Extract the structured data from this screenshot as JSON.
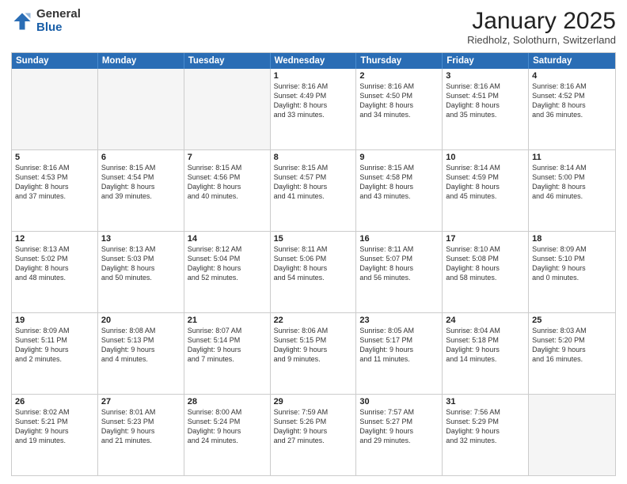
{
  "header": {
    "logo_general": "General",
    "logo_blue": "Blue",
    "title": "January 2025",
    "subtitle": "Riedholz, Solothurn, Switzerland"
  },
  "days_of_week": [
    "Sunday",
    "Monday",
    "Tuesday",
    "Wednesday",
    "Thursday",
    "Friday",
    "Saturday"
  ],
  "weeks": [
    [
      {
        "day": "",
        "info": "",
        "empty": true
      },
      {
        "day": "",
        "info": "",
        "empty": true
      },
      {
        "day": "",
        "info": "",
        "empty": true
      },
      {
        "day": "1",
        "info": "Sunrise: 8:16 AM\nSunset: 4:49 PM\nDaylight: 8 hours\nand 33 minutes."
      },
      {
        "day": "2",
        "info": "Sunrise: 8:16 AM\nSunset: 4:50 PM\nDaylight: 8 hours\nand 34 minutes."
      },
      {
        "day": "3",
        "info": "Sunrise: 8:16 AM\nSunset: 4:51 PM\nDaylight: 8 hours\nand 35 minutes."
      },
      {
        "day": "4",
        "info": "Sunrise: 8:16 AM\nSunset: 4:52 PM\nDaylight: 8 hours\nand 36 minutes."
      }
    ],
    [
      {
        "day": "5",
        "info": "Sunrise: 8:16 AM\nSunset: 4:53 PM\nDaylight: 8 hours\nand 37 minutes."
      },
      {
        "day": "6",
        "info": "Sunrise: 8:15 AM\nSunset: 4:54 PM\nDaylight: 8 hours\nand 39 minutes."
      },
      {
        "day": "7",
        "info": "Sunrise: 8:15 AM\nSunset: 4:56 PM\nDaylight: 8 hours\nand 40 minutes."
      },
      {
        "day": "8",
        "info": "Sunrise: 8:15 AM\nSunset: 4:57 PM\nDaylight: 8 hours\nand 41 minutes."
      },
      {
        "day": "9",
        "info": "Sunrise: 8:15 AM\nSunset: 4:58 PM\nDaylight: 8 hours\nand 43 minutes."
      },
      {
        "day": "10",
        "info": "Sunrise: 8:14 AM\nSunset: 4:59 PM\nDaylight: 8 hours\nand 45 minutes."
      },
      {
        "day": "11",
        "info": "Sunrise: 8:14 AM\nSunset: 5:00 PM\nDaylight: 8 hours\nand 46 minutes."
      }
    ],
    [
      {
        "day": "12",
        "info": "Sunrise: 8:13 AM\nSunset: 5:02 PM\nDaylight: 8 hours\nand 48 minutes."
      },
      {
        "day": "13",
        "info": "Sunrise: 8:13 AM\nSunset: 5:03 PM\nDaylight: 8 hours\nand 50 minutes."
      },
      {
        "day": "14",
        "info": "Sunrise: 8:12 AM\nSunset: 5:04 PM\nDaylight: 8 hours\nand 52 minutes."
      },
      {
        "day": "15",
        "info": "Sunrise: 8:11 AM\nSunset: 5:06 PM\nDaylight: 8 hours\nand 54 minutes."
      },
      {
        "day": "16",
        "info": "Sunrise: 8:11 AM\nSunset: 5:07 PM\nDaylight: 8 hours\nand 56 minutes."
      },
      {
        "day": "17",
        "info": "Sunrise: 8:10 AM\nSunset: 5:08 PM\nDaylight: 8 hours\nand 58 minutes."
      },
      {
        "day": "18",
        "info": "Sunrise: 8:09 AM\nSunset: 5:10 PM\nDaylight: 9 hours\nand 0 minutes."
      }
    ],
    [
      {
        "day": "19",
        "info": "Sunrise: 8:09 AM\nSunset: 5:11 PM\nDaylight: 9 hours\nand 2 minutes."
      },
      {
        "day": "20",
        "info": "Sunrise: 8:08 AM\nSunset: 5:13 PM\nDaylight: 9 hours\nand 4 minutes."
      },
      {
        "day": "21",
        "info": "Sunrise: 8:07 AM\nSunset: 5:14 PM\nDaylight: 9 hours\nand 7 minutes."
      },
      {
        "day": "22",
        "info": "Sunrise: 8:06 AM\nSunset: 5:15 PM\nDaylight: 9 hours\nand 9 minutes."
      },
      {
        "day": "23",
        "info": "Sunrise: 8:05 AM\nSunset: 5:17 PM\nDaylight: 9 hours\nand 11 minutes."
      },
      {
        "day": "24",
        "info": "Sunrise: 8:04 AM\nSunset: 5:18 PM\nDaylight: 9 hours\nand 14 minutes."
      },
      {
        "day": "25",
        "info": "Sunrise: 8:03 AM\nSunset: 5:20 PM\nDaylight: 9 hours\nand 16 minutes."
      }
    ],
    [
      {
        "day": "26",
        "info": "Sunrise: 8:02 AM\nSunset: 5:21 PM\nDaylight: 9 hours\nand 19 minutes."
      },
      {
        "day": "27",
        "info": "Sunrise: 8:01 AM\nSunset: 5:23 PM\nDaylight: 9 hours\nand 21 minutes."
      },
      {
        "day": "28",
        "info": "Sunrise: 8:00 AM\nSunset: 5:24 PM\nDaylight: 9 hours\nand 24 minutes."
      },
      {
        "day": "29",
        "info": "Sunrise: 7:59 AM\nSunset: 5:26 PM\nDaylight: 9 hours\nand 27 minutes."
      },
      {
        "day": "30",
        "info": "Sunrise: 7:57 AM\nSunset: 5:27 PM\nDaylight: 9 hours\nand 29 minutes."
      },
      {
        "day": "31",
        "info": "Sunrise: 7:56 AM\nSunset: 5:29 PM\nDaylight: 9 hours\nand 32 minutes."
      },
      {
        "day": "",
        "info": "",
        "empty": true
      }
    ]
  ]
}
